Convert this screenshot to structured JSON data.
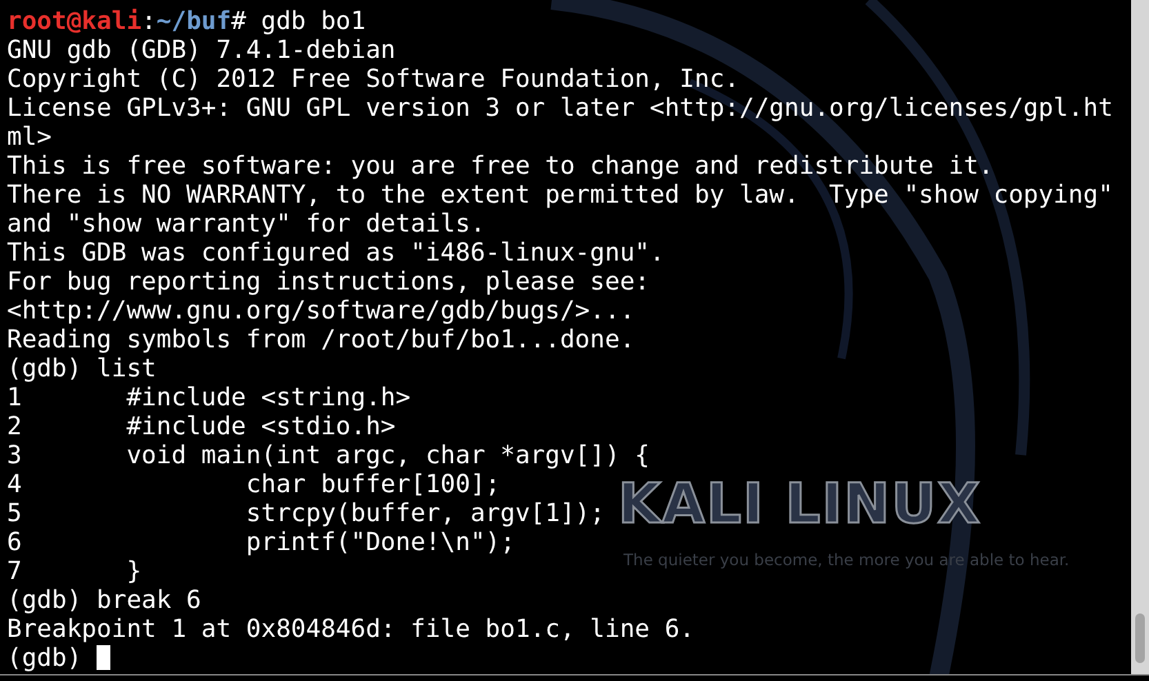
{
  "wallpaper": {
    "logo": "KALI LINUX",
    "tagline": "The quieter you become, the more you are able to hear."
  },
  "terminal": {
    "lines": [
      {
        "kind": "prompt",
        "user_host": "root@kali",
        "separator": ":",
        "path": "~/buf",
        "symbol": "#",
        "command": " gdb bo1"
      },
      {
        "kind": "output",
        "text": "GNU gdb (GDB) 7.4.1-debian"
      },
      {
        "kind": "output",
        "text": "Copyright (C) 2012 Free Software Foundation, Inc."
      },
      {
        "kind": "output",
        "text": "License GPLv3+: GNU GPL version 3 or later <http://gnu.org/licenses/gpl.ht"
      },
      {
        "kind": "output",
        "text": "ml>"
      },
      {
        "kind": "output",
        "text": "This is free software: you are free to change and redistribute it."
      },
      {
        "kind": "output",
        "text": "There is NO WARRANTY, to the extent permitted by law.  Type \"show copying\""
      },
      {
        "kind": "output",
        "text": "and \"show warranty\" for details."
      },
      {
        "kind": "output",
        "text": "This GDB was configured as \"i486-linux-gnu\"."
      },
      {
        "kind": "output",
        "text": "For bug reporting instructions, please see:"
      },
      {
        "kind": "output",
        "text": "<http://www.gnu.org/software/gdb/bugs/>..."
      },
      {
        "kind": "output",
        "text": "Reading symbols from /root/buf/bo1...done."
      },
      {
        "kind": "output",
        "text": "(gdb) list"
      },
      {
        "kind": "output",
        "text": "1\t#include <string.h>"
      },
      {
        "kind": "output",
        "text": "2\t#include <stdio.h>"
      },
      {
        "kind": "output",
        "text": "3\tvoid main(int argc, char *argv[]) {"
      },
      {
        "kind": "output",
        "text": "4\t\tchar buffer[100];"
      },
      {
        "kind": "output",
        "text": "5\t\tstrcpy(buffer, argv[1]);"
      },
      {
        "kind": "output",
        "text": "6\t\tprintf(\"Done!\\n\");"
      },
      {
        "kind": "output",
        "text": "7\t}"
      },
      {
        "kind": "output",
        "text": "(gdb) break 6"
      },
      {
        "kind": "output",
        "text": "Breakpoint 1 at 0x804846d: file bo1.c, line 6."
      },
      {
        "kind": "input",
        "text": "(gdb) "
      }
    ]
  }
}
